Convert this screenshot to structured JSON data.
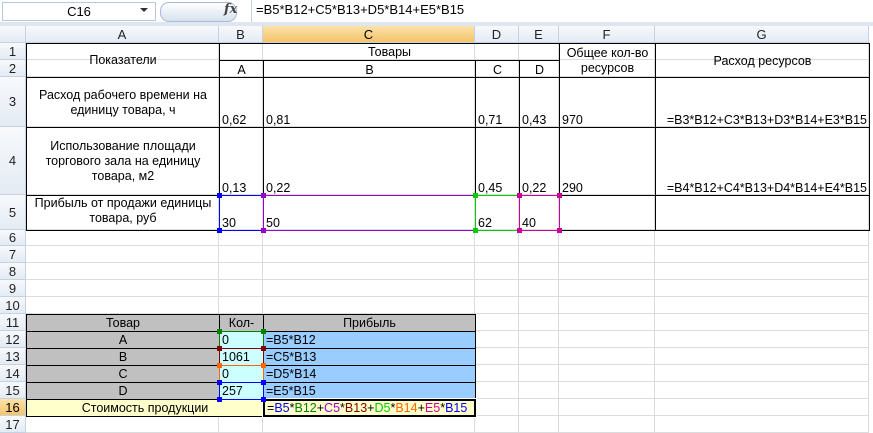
{
  "formula_bar": {
    "name_box": "C16",
    "fx_icon": "fx-icon",
    "formula": "=B5*B12+C5*B13+D5*B14+E5*B15"
  },
  "columns": [
    "A",
    "B",
    "C",
    "D",
    "E",
    "F",
    "G"
  ],
  "rows": [
    "1",
    "2",
    "3",
    "4",
    "5",
    "6",
    "7",
    "8",
    "9",
    "10",
    "11",
    "12",
    "13",
    "14",
    "15",
    "16",
    "17"
  ],
  "selected": {
    "column": "C",
    "row": "16"
  },
  "colors": {
    "gray_fill": "#c0c0c0",
    "cyan_fill": "#ccffff",
    "blue_fill": "#99ccff",
    "yellow_fill": "#ffffcc"
  },
  "cells": {
    "A1": "Показатели",
    "B1": "Товары",
    "F1": "Общее кол-во ресурсов",
    "G1": "Расход ресурсов",
    "B2": "A",
    "C2": "B",
    "D2": "C",
    "E2": "D",
    "A3": "Расход рабочего времени на единицу товара, ч",
    "B3": "0,62",
    "C3": "0,81",
    "D3": "0,71",
    "E3": "0,43",
    "F3": "970",
    "G3": "=B3*B12+C3*B13+D3*B14+E3*B15",
    "A4": "Использование площади торгового зала  на единицу товара, м2",
    "B4": "0,13",
    "C4": "0,22",
    "D4": "0,45",
    "E4": "0,22",
    "F4": "290",
    "G4": "=B4*B12+C4*B13+D4*B14+E4*B15",
    "A5": "Прибыль от продажи единицы товара, руб",
    "B5": "30",
    "C5": "50",
    "D5": "62",
    "E5": "40",
    "A11": "Товар",
    "B11": "Кол-",
    "C11": "Прибыль",
    "A12": "A",
    "B12": "0",
    "C12": "=B5*B12",
    "A13": "B",
    "B13": "1061",
    "C13": "=C5*B13",
    "A14": "C",
    "B14": "0",
    "C14": "=D5*B14",
    "A15": "D",
    "B15": "257",
    "C15": "=E5*B15",
    "A16": "Стоимость продукции"
  },
  "active_cell_formula": [
    {
      "t": "=",
      "c": "#000000"
    },
    {
      "t": "B5",
      "c": "#0000ff"
    },
    {
      "t": "*",
      "c": "#000000"
    },
    {
      "t": "B12",
      "c": "#008000"
    },
    {
      "t": "+",
      "c": "#000000"
    },
    {
      "t": "C5",
      "c": "#9900cc"
    },
    {
      "t": "*",
      "c": "#000000"
    },
    {
      "t": "B13",
      "c": "#800000"
    },
    {
      "t": "+",
      "c": "#000000"
    },
    {
      "t": "D5",
      "c": "#00cc00"
    },
    {
      "t": "*",
      "c": "#000000"
    },
    {
      "t": "B14",
      "c": "#ff6600"
    },
    {
      "t": "+",
      "c": "#000000"
    },
    {
      "t": "E5",
      "c": "#cc0099"
    },
    {
      "t": "*",
      "c": "#000000"
    },
    {
      "t": "B15",
      "c": "#0000ff"
    }
  ]
}
